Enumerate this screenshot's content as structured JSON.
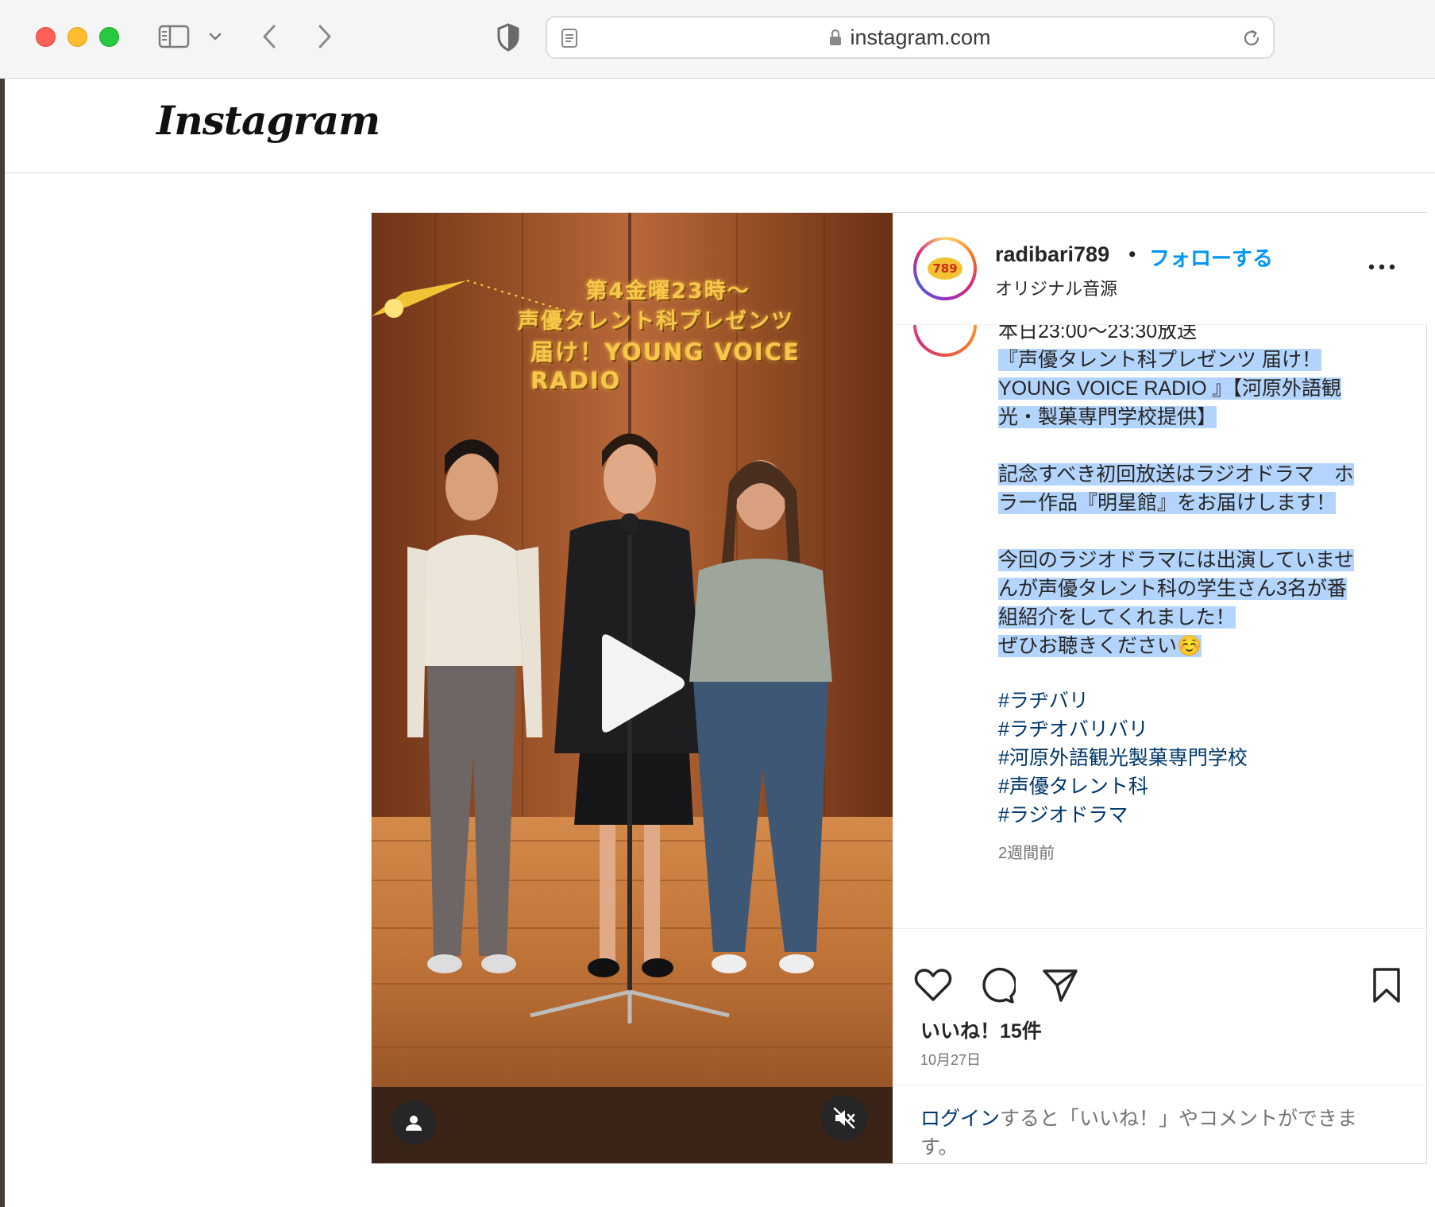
{
  "browser": {
    "url": "instagram.com"
  },
  "instagram": {
    "logo": "Instagram"
  },
  "post": {
    "video": {
      "caption_line_1": "第4金曜23時～",
      "caption_line_2": "声優タレント科プレゼンツ",
      "caption_line_3": "届け！YOUNG VOICE RADIO",
      "avatar_logo_text": "789"
    },
    "header": {
      "username": "radibari789",
      "separator": "•",
      "follow_label": "フォローする",
      "audio_label": "オリジナル音源"
    },
    "caption": {
      "first_line": "本日23:00〜23:30放送",
      "lines": [
        "『声優タレント科プレゼンツ 届け！",
        "YOUNG VOICE RADIO 』【河原外語観",
        "光・製菓専門学校提供】",
        "",
        "記念すべき初回放送はラジオドラマ　ホ",
        "ラー作品『明星館』をお届けします！",
        "",
        "今回のラジオドラマには出演していませ",
        "んが声優タレント科の学生さん3名が番",
        "組紹介をしてくれました！",
        "ぜひお聴きください☺️"
      ],
      "hashtags": [
        "#ラヂバリ",
        "#ラヂオバリバリ",
        "#河原外語観光製菓専門学校",
        "#声優タレント科",
        "#ラジオドラマ"
      ],
      "posted_ago": "2週間前"
    },
    "likes_label": "いいね！15件",
    "date": "10月27日",
    "login_prompt": {
      "link_text": "ログイン",
      "rest_line_1": "すると「いいね！」やコメントができま",
      "line_2": "す。"
    }
  },
  "colors": {
    "follow_blue": "#0095f6",
    "hashtag_blue": "#00376b",
    "selection": "#b3d4fc",
    "border": "#dbdbdb"
  },
  "icons": [
    "sidebar-icon",
    "chevron-down-icon",
    "back-icon",
    "forward-icon",
    "shield-icon",
    "reader-icon",
    "lock-icon",
    "reload-icon",
    "play-icon",
    "user-tag-icon",
    "muted-icon",
    "more-icon",
    "heart-icon",
    "comment-icon",
    "share-icon",
    "bookmark-icon"
  ]
}
